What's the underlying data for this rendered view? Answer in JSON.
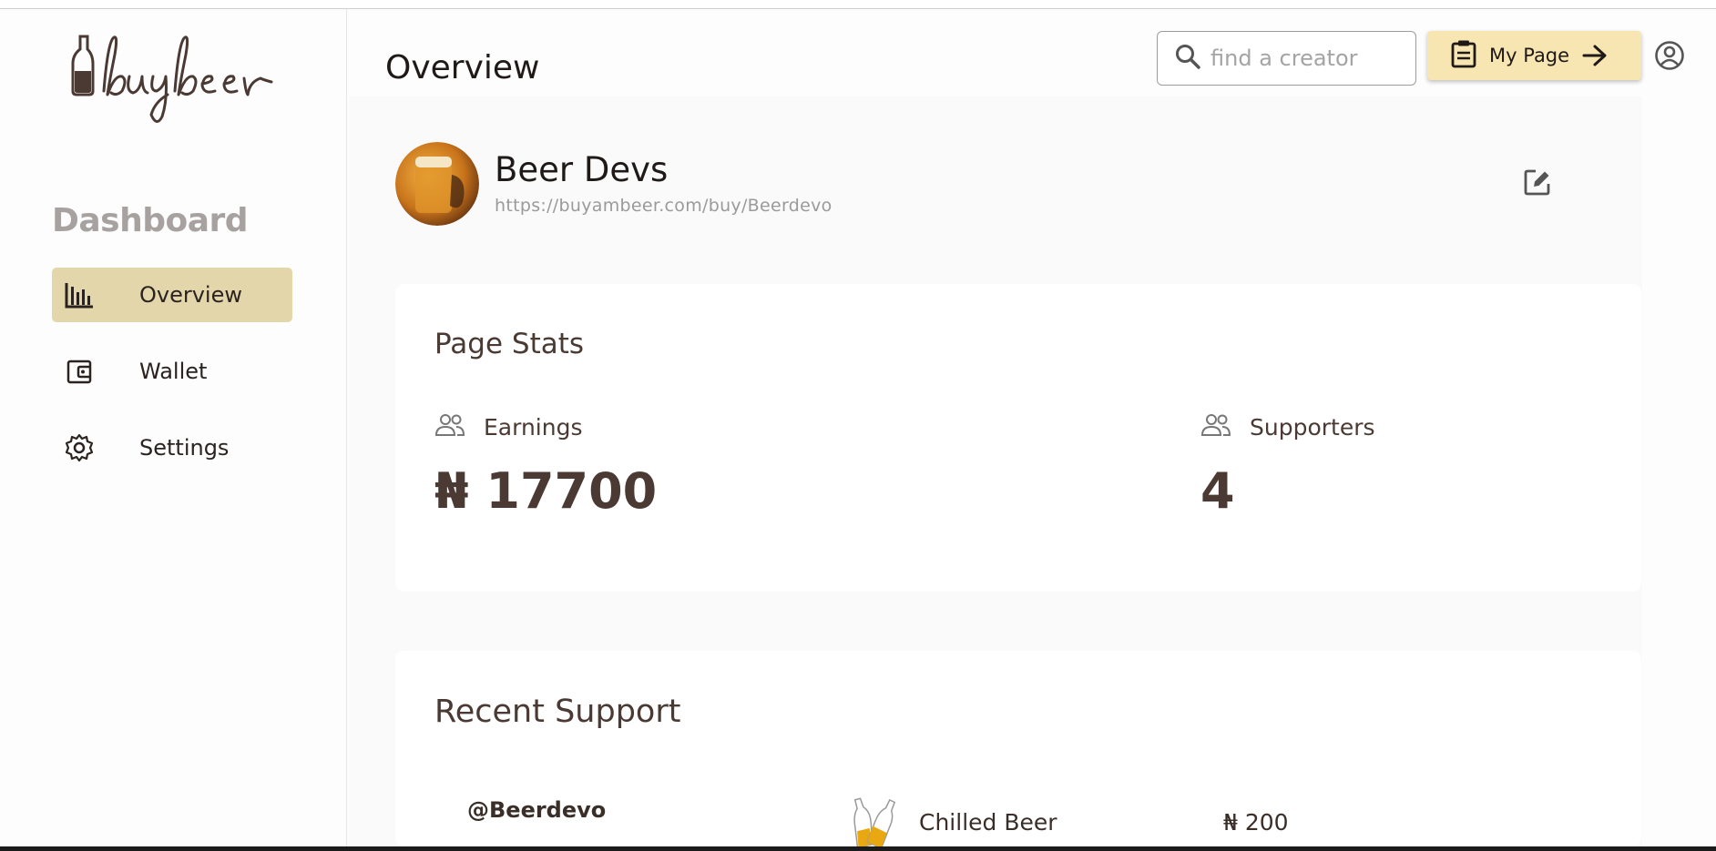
{
  "brand": {
    "logo_text": "buybeer"
  },
  "sidebar": {
    "title": "Dashboard",
    "items": [
      {
        "label": "Overview",
        "icon": "bar-chart-icon",
        "active": true
      },
      {
        "label": "Wallet",
        "icon": "wallet-icon",
        "active": false
      },
      {
        "label": "Settings",
        "icon": "gear-icon",
        "active": false
      }
    ]
  },
  "header": {
    "title": "Overview",
    "search_placeholder": "find a creator",
    "my_page_label": "My Page"
  },
  "profile": {
    "name": "Beer Devs",
    "url": "https://buyambeer.com/buy/Beerdevo"
  },
  "stats": {
    "title": "Page Stats",
    "earnings_label": "Earnings",
    "earnings_value": "₦ 17700",
    "supporters_label": "Supporters",
    "supporters_value": "4"
  },
  "recent_support": {
    "title": "Recent Support",
    "rows": [
      {
        "user": "@Beerdevo",
        "item": "Chilled Beer",
        "amount": "₦ 200"
      }
    ]
  },
  "colors": {
    "accent": "#e4d6ab",
    "button": "#f7e6b2",
    "text_brown": "#4a3a33"
  }
}
